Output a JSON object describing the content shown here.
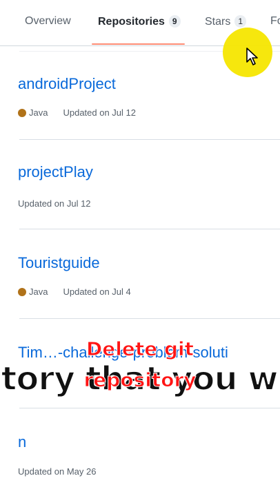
{
  "tabs": [
    {
      "label": "Overview",
      "count": null
    },
    {
      "label": "Repositories",
      "count": "9"
    },
    {
      "label": "Stars",
      "count": "1"
    },
    {
      "label": "Fo",
      "count": null
    }
  ],
  "repos": [
    {
      "name": "androidProject",
      "language": "Java",
      "updated": "Updated on Jul 12"
    },
    {
      "name": "projectPlay",
      "language": null,
      "updated": "Updated on Jul 12"
    },
    {
      "name": "Touristguide",
      "language": "Java",
      "updated": "Updated on Jul 4"
    },
    {
      "name": "Tim…-challenge-problem-soluti",
      "language": null,
      "updated": ""
    },
    {
      "name": "n",
      "language": null,
      "updated": "Updated on May 26"
    }
  ],
  "caption": {
    "subtitle": "itory that you will c",
    "overlay_line1": "Delete git",
    "overlay_line2": "repository"
  },
  "colors": {
    "link": "#0969da",
    "java": "#b07219",
    "tab_underline": "#fd8c73",
    "cursor_halo": "#f6e600",
    "overlay_text": "#ff1414"
  }
}
